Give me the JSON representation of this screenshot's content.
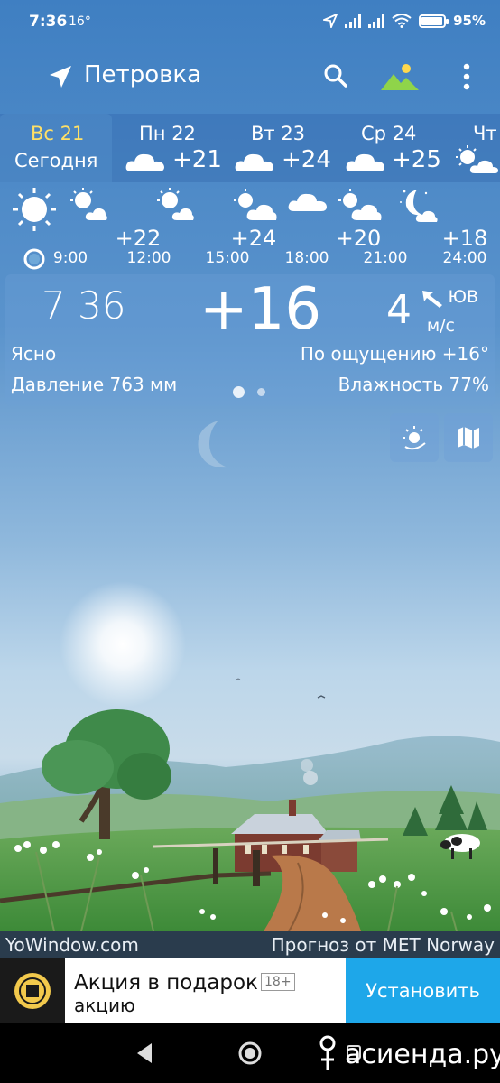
{
  "status_bar": {
    "time": "7:36",
    "temp": "16°",
    "battery": "95%",
    "battery_level": 0.95
  },
  "header": {
    "city": "Петровка",
    "icons": [
      "location-arrow-icon",
      "search-icon",
      "landscape-icon",
      "more-vert-icon"
    ]
  },
  "days": [
    {
      "name": "Вс 21",
      "sub": "Сегодня",
      "selected": true
    },
    {
      "name": "Пн 22",
      "temp": "+21",
      "icon": "cloud-icon"
    },
    {
      "name": "Вт 23",
      "temp": "+24",
      "icon": "cloud-icon"
    },
    {
      "name": "Ср 24",
      "temp": "+25",
      "icon": "cloud-icon"
    },
    {
      "name": "Чт",
      "icon": "partly-cloudy-icon"
    }
  ],
  "hourly": {
    "temps": [
      "+22",
      "+24",
      "+20",
      "+18"
    ],
    "labels": [
      "9:00",
      "12:00",
      "15:00",
      "18:00",
      "21:00",
      "24:00"
    ]
  },
  "current": {
    "time": "7 36",
    "temp": "+16",
    "wind_speed": "4",
    "wind_dir": "ЮВ",
    "wind_unit": "м/с",
    "condition": "Ясно",
    "feels_like": "По ощущению +16°",
    "pressure": "Давление 763 мм",
    "humidity": "Влажность 77%"
  },
  "footer": {
    "left": "YoWindow.com",
    "right": "Прогноз от MET Norway"
  },
  "ad": {
    "title": "Акция в подарок",
    "age": "18+",
    "subtitle": "акцию",
    "button": "Установить"
  },
  "watermark": "асиенда.ру",
  "colors": {
    "accent": "#1ea7e9",
    "selected_day_text": "#ffe066"
  }
}
